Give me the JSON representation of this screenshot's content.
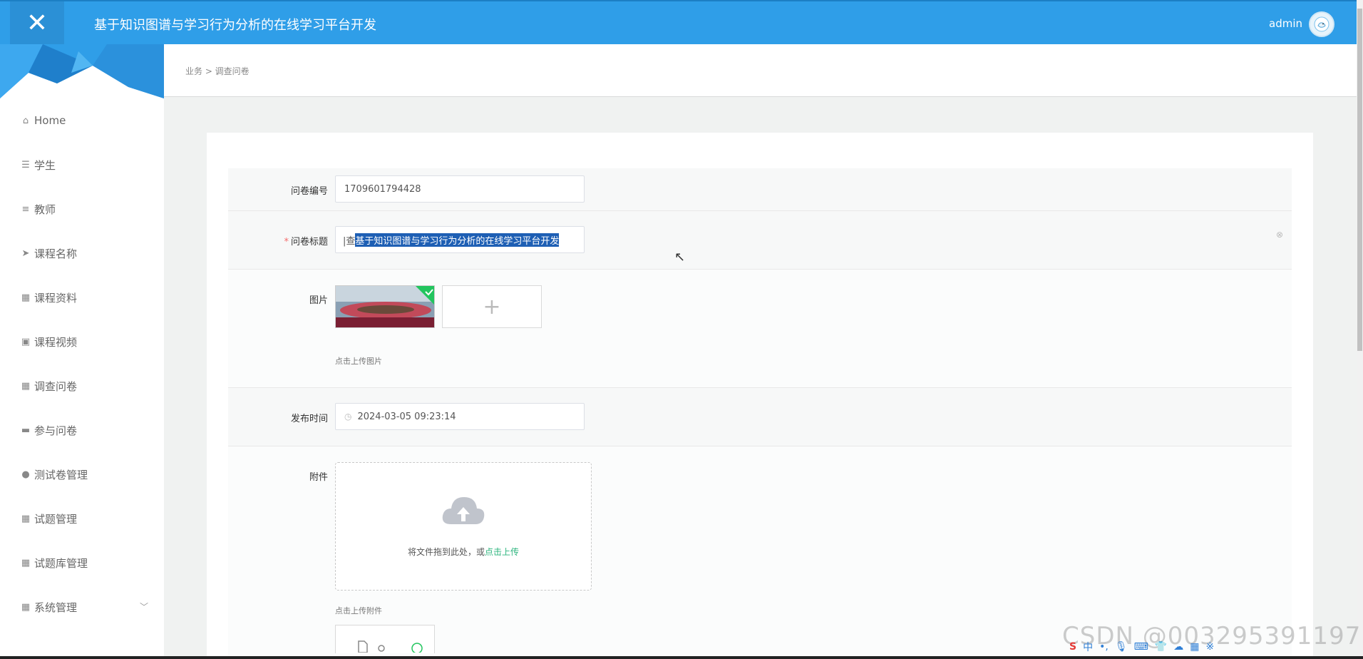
{
  "header": {
    "close_icon": "✕",
    "title": "基于知识图谱与学习行为分析的在线学习平台开发",
    "user": "admin"
  },
  "breadcrumb": "业务 > 调查问卷",
  "sidebar": {
    "items": [
      {
        "label": "Home",
        "icon": "⌂"
      },
      {
        "label": "学生",
        "icon": "☰"
      },
      {
        "label": "教师",
        "icon": "≡"
      },
      {
        "label": "课程名称",
        "icon": "➤"
      },
      {
        "label": "课程资料",
        "icon": "▦"
      },
      {
        "label": "课程视频",
        "icon": "▣"
      },
      {
        "label": "调查问卷",
        "icon": "▦"
      },
      {
        "label": "参与问卷",
        "icon": "▬"
      },
      {
        "label": "测试卷管理",
        "icon": "●"
      },
      {
        "label": "试题管理",
        "icon": "▦"
      },
      {
        "label": "试题库管理",
        "icon": "▦"
      },
      {
        "label": "系统管理",
        "icon": "▦",
        "chevron": "﹀"
      }
    ]
  },
  "form": {
    "survey_no_label": "问卷编号",
    "survey_no_value": "1709601794428",
    "title_required": "*",
    "title_label": "问卷标题",
    "title_prefix": "|查",
    "title_selected": "基于知识图谱与学习行为分析的在线学习平台开发",
    "image_label": "图片",
    "image_add": "+",
    "image_hint": "点击上传图片",
    "publish_label": "发布时间",
    "publish_value": "2024-03-05 09:23:14",
    "attachment_label": "附件",
    "upload_text": "将文件拖到此处，或",
    "upload_link": "点击上传",
    "attachment_hint": "点击上传附件"
  },
  "watermark": "CSDN @003295391197",
  "ime_bar": [
    "S",
    "中",
    "•,",
    "🎙",
    "⌨",
    "👕",
    "☁",
    "▦",
    "※"
  ],
  "colors": {
    "header_bg": "#2f9ee8",
    "selection": "#1e5fb4",
    "upload_link": "#2db57e",
    "required": "#f56c6c"
  }
}
